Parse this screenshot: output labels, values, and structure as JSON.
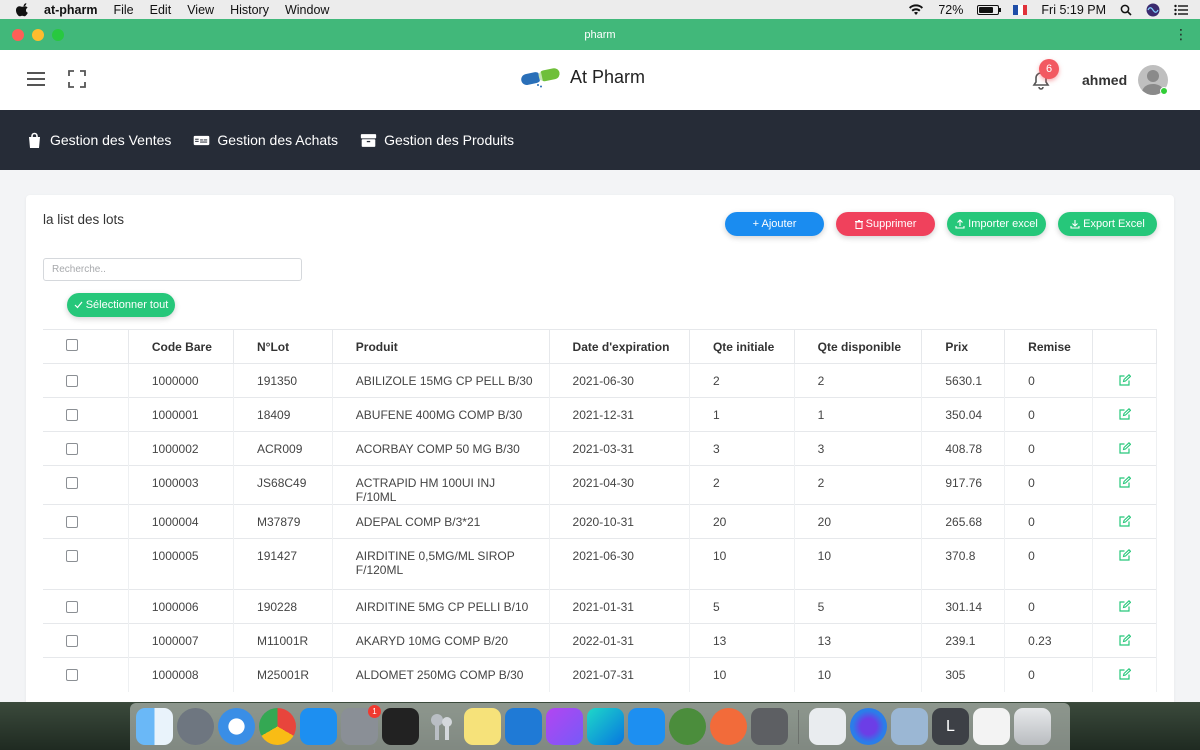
{
  "menubar": {
    "app_name": "at-pharm",
    "menus": [
      "File",
      "Edit",
      "View",
      "History",
      "Window"
    ],
    "battery": "72%",
    "clock": "Fri 5:19 PM"
  },
  "window": {
    "title": "pharm"
  },
  "header": {
    "brand": "At Pharm",
    "notifications": "6",
    "username": "ahmed"
  },
  "nav": {
    "items": [
      {
        "label": "Gestion des Ventes",
        "icon": "shopping-bag-icon"
      },
      {
        "label": "Gestion des Achats",
        "icon": "credit-card-icon"
      },
      {
        "label": "Gestion des Produits",
        "icon": "archive-box-icon"
      }
    ]
  },
  "card": {
    "title": "la list des lots",
    "buttons": {
      "add": "+ Ajouter",
      "delete": "Supprimer",
      "import": "Importer excel",
      "export": "Export Excel"
    },
    "search_placeholder": "Recherche..",
    "select_all": "Sélectionner tout"
  },
  "table": {
    "headers": [
      "Code Bare",
      "N°Lot",
      "Produit",
      "Date d'expiration",
      "Qte initiale",
      "Qte disponible",
      "Prix",
      "Remise"
    ],
    "rows": [
      {
        "code": "1000000",
        "lot": "191350",
        "produit": "ABILIZOLE 15MG CP PELL B/30",
        "date": "2021-06-30",
        "qte_init": "2",
        "qte_dispo": "2",
        "prix": "5630.1",
        "remise": "0"
      },
      {
        "code": "1000001",
        "lot": "18409",
        "produit": "ABUFENE 400MG COMP B/30",
        "date": "2021-12-31",
        "qte_init": "1",
        "qte_dispo": "1",
        "prix": "350.04",
        "remise": "0"
      },
      {
        "code": "1000002",
        "lot": "ACR009",
        "produit": "ACORBAY COMP 50 MG B/30",
        "date": "2021-03-31",
        "qte_init": "3",
        "qte_dispo": "3",
        "prix": "408.78",
        "remise": "0"
      },
      {
        "code": "1000003",
        "lot": "JS68C49",
        "produit": "ACTRAPID HM 100UI INJ F/10ML",
        "date": "2021-04-30",
        "qte_init": "2",
        "qte_dispo": "2",
        "prix": "917.76",
        "remise": "0"
      },
      {
        "code": "1000004",
        "lot": "M37879",
        "produit": "ADEPAL COMP B/3*21",
        "date": "2020-10-31",
        "qte_init": "20",
        "qte_dispo": "20",
        "prix": "265.68",
        "remise": "0"
      },
      {
        "code": "1000005",
        "lot": "191427",
        "produit": "AIRDITINE 0,5MG/ML SIROP F/120ML",
        "date": "2021-06-30",
        "qte_init": "10",
        "qte_dispo": "10",
        "prix": "370.8",
        "remise": "0"
      },
      {
        "code": "1000006",
        "lot": "190228",
        "produit": "AIRDITINE 5MG CP PELLI B/10",
        "date": "2021-01-31",
        "qte_init": "5",
        "qte_dispo": "5",
        "prix": "301.14",
        "remise": "0"
      },
      {
        "code": "1000007",
        "lot": "M11001R",
        "produit": "AKARYD 10MG COMP B/20",
        "date": "2022-01-31",
        "qte_init": "13",
        "qte_dispo": "13",
        "prix": "239.1",
        "remise": "0.23"
      },
      {
        "code": "1000008",
        "lot": "M25001R",
        "produit": "ALDOMET 250MG COMP B/30",
        "date": "2021-07-31",
        "qte_init": "10",
        "qte_dispo": "10",
        "prix": "305",
        "remise": "0"
      }
    ]
  },
  "dock": {
    "apps": [
      "finder-icon",
      "launchpad-icon",
      "safari-icon",
      "chrome-icon",
      "app-store-icon",
      "system-preferences-icon",
      "terminal-icon",
      "keychain-icon",
      "stickies-icon",
      "vscode-icon",
      "phpstorm-icon",
      "webstorm-icon",
      "xcode-icon",
      "android-studio-icon",
      "postman-icon",
      "calculator-icon",
      "tableplus-icon",
      "firefox-icon",
      "preview-icon",
      "l-app-icon",
      "screenshot-icon",
      "trash-icon"
    ],
    "system_prefs_badge": "1"
  },
  "colors": {
    "titlebar": "#41b87a",
    "navbar": "#262c37",
    "accent_blue": "#1a8cf0",
    "accent_red": "#f0415c",
    "accent_green": "#26c77a"
  }
}
